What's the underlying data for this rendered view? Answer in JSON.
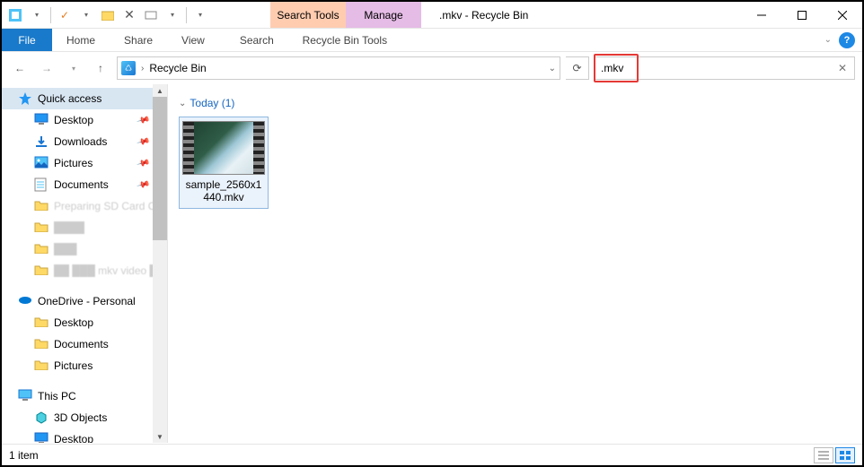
{
  "window": {
    "title": ".mkv - Recycle Bin",
    "context_tabs": {
      "search": "Search Tools",
      "manage": "Manage"
    }
  },
  "ribbon": {
    "file": "File",
    "tabs": [
      "Home",
      "Share",
      "View",
      "Search",
      "Recycle Bin Tools"
    ]
  },
  "nav": {
    "location": "Recycle Bin",
    "search_value": ".mkv"
  },
  "sidebar": {
    "quick_access": "Quick access",
    "qa_items": [
      {
        "label": "Desktop",
        "icon": "desktop",
        "pinned": true
      },
      {
        "label": "Downloads",
        "icon": "downloads",
        "pinned": true
      },
      {
        "label": "Pictures",
        "icon": "pictures",
        "pinned": true
      },
      {
        "label": "Documents",
        "icon": "documents",
        "pinned": true
      },
      {
        "label": "Preparing SD Card Check",
        "icon": "folder",
        "pinned": false,
        "blur": true
      },
      {
        "label": "████",
        "icon": "folder",
        "pinned": false,
        "blur": true
      },
      {
        "label": "███",
        "icon": "folder",
        "pinned": false,
        "blur": true
      },
      {
        "label": "██ ███ mkv video ██",
        "icon": "folder",
        "pinned": false,
        "blur": true
      }
    ],
    "onedrive": "OneDrive - Personal",
    "od_items": [
      {
        "label": "Desktop",
        "icon": "folder"
      },
      {
        "label": "Documents",
        "icon": "folder"
      },
      {
        "label": "Pictures",
        "icon": "folder"
      }
    ],
    "thispc": "This PC",
    "pc_items": [
      {
        "label": "3D Objects",
        "icon": "3d"
      },
      {
        "label": "Desktop",
        "icon": "desktop"
      }
    ]
  },
  "content": {
    "group": "Today (1)",
    "files": [
      {
        "name": "sample_2560x1440.mkv"
      }
    ]
  },
  "status": {
    "text": "1 item"
  }
}
